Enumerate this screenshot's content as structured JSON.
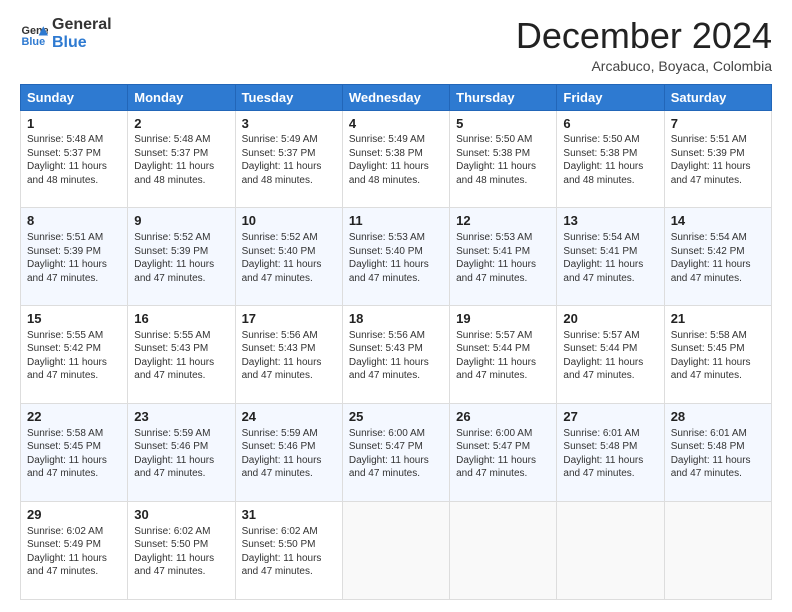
{
  "logo": {
    "line1": "General",
    "line2": "Blue"
  },
  "header": {
    "month": "December 2024",
    "location": "Arcabuco, Boyaca, Colombia"
  },
  "weekdays": [
    "Sunday",
    "Monday",
    "Tuesday",
    "Wednesday",
    "Thursday",
    "Friday",
    "Saturday"
  ],
  "weeks": [
    [
      {
        "day": "1",
        "rise": "5:48 AM",
        "set": "5:37 PM",
        "daylight": "11 hours and 48 minutes."
      },
      {
        "day": "2",
        "rise": "5:48 AM",
        "set": "5:37 PM",
        "daylight": "11 hours and 48 minutes."
      },
      {
        "day": "3",
        "rise": "5:49 AM",
        "set": "5:37 PM",
        "daylight": "11 hours and 48 minutes."
      },
      {
        "day": "4",
        "rise": "5:49 AM",
        "set": "5:38 PM",
        "daylight": "11 hours and 48 minutes."
      },
      {
        "day": "5",
        "rise": "5:50 AM",
        "set": "5:38 PM",
        "daylight": "11 hours and 48 minutes."
      },
      {
        "day": "6",
        "rise": "5:50 AM",
        "set": "5:38 PM",
        "daylight": "11 hours and 48 minutes."
      },
      {
        "day": "7",
        "rise": "5:51 AM",
        "set": "5:39 PM",
        "daylight": "11 hours and 47 minutes."
      }
    ],
    [
      {
        "day": "8",
        "rise": "5:51 AM",
        "set": "5:39 PM",
        "daylight": "11 hours and 47 minutes."
      },
      {
        "day": "9",
        "rise": "5:52 AM",
        "set": "5:39 PM",
        "daylight": "11 hours and 47 minutes."
      },
      {
        "day": "10",
        "rise": "5:52 AM",
        "set": "5:40 PM",
        "daylight": "11 hours and 47 minutes."
      },
      {
        "day": "11",
        "rise": "5:53 AM",
        "set": "5:40 PM",
        "daylight": "11 hours and 47 minutes."
      },
      {
        "day": "12",
        "rise": "5:53 AM",
        "set": "5:41 PM",
        "daylight": "11 hours and 47 minutes."
      },
      {
        "day": "13",
        "rise": "5:54 AM",
        "set": "5:41 PM",
        "daylight": "11 hours and 47 minutes."
      },
      {
        "day": "14",
        "rise": "5:54 AM",
        "set": "5:42 PM",
        "daylight": "11 hours and 47 minutes."
      }
    ],
    [
      {
        "day": "15",
        "rise": "5:55 AM",
        "set": "5:42 PM",
        "daylight": "11 hours and 47 minutes."
      },
      {
        "day": "16",
        "rise": "5:55 AM",
        "set": "5:43 PM",
        "daylight": "11 hours and 47 minutes."
      },
      {
        "day": "17",
        "rise": "5:56 AM",
        "set": "5:43 PM",
        "daylight": "11 hours and 47 minutes."
      },
      {
        "day": "18",
        "rise": "5:56 AM",
        "set": "5:43 PM",
        "daylight": "11 hours and 47 minutes."
      },
      {
        "day": "19",
        "rise": "5:57 AM",
        "set": "5:44 PM",
        "daylight": "11 hours and 47 minutes."
      },
      {
        "day": "20",
        "rise": "5:57 AM",
        "set": "5:44 PM",
        "daylight": "11 hours and 47 minutes."
      },
      {
        "day": "21",
        "rise": "5:58 AM",
        "set": "5:45 PM",
        "daylight": "11 hours and 47 minutes."
      }
    ],
    [
      {
        "day": "22",
        "rise": "5:58 AM",
        "set": "5:45 PM",
        "daylight": "11 hours and 47 minutes."
      },
      {
        "day": "23",
        "rise": "5:59 AM",
        "set": "5:46 PM",
        "daylight": "11 hours and 47 minutes."
      },
      {
        "day": "24",
        "rise": "5:59 AM",
        "set": "5:46 PM",
        "daylight": "11 hours and 47 minutes."
      },
      {
        "day": "25",
        "rise": "6:00 AM",
        "set": "5:47 PM",
        "daylight": "11 hours and 47 minutes."
      },
      {
        "day": "26",
        "rise": "6:00 AM",
        "set": "5:47 PM",
        "daylight": "11 hours and 47 minutes."
      },
      {
        "day": "27",
        "rise": "6:01 AM",
        "set": "5:48 PM",
        "daylight": "11 hours and 47 minutes."
      },
      {
        "day": "28",
        "rise": "6:01 AM",
        "set": "5:48 PM",
        "daylight": "11 hours and 47 minutes."
      }
    ],
    [
      {
        "day": "29",
        "rise": "6:02 AM",
        "set": "5:49 PM",
        "daylight": "11 hours and 47 minutes."
      },
      {
        "day": "30",
        "rise": "6:02 AM",
        "set": "5:50 PM",
        "daylight": "11 hours and 47 minutes."
      },
      {
        "day": "31",
        "rise": "6:02 AM",
        "set": "5:50 PM",
        "daylight": "11 hours and 47 minutes."
      },
      null,
      null,
      null,
      null
    ]
  ],
  "labels": {
    "sunrise": "Sunrise:",
    "sunset": "Sunset:",
    "daylight": "Daylight:"
  }
}
